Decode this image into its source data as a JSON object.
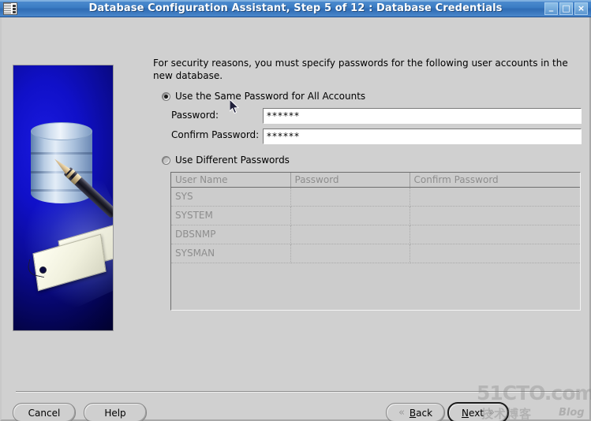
{
  "window": {
    "title": "Database Configuration Assistant, Step 5 of 12 : Database Credentials",
    "app_icon": "database-config-icon",
    "controls": {
      "minimize": "_",
      "maximize": "□",
      "close": "×"
    }
  },
  "main": {
    "instructions": "For security reasons, you must specify passwords for the following user accounts in the new database.",
    "same_password_option": {
      "label": "Use the Same Password for All Accounts",
      "selected": true
    },
    "different_password_option": {
      "label": "Use Different Passwords",
      "selected": false
    },
    "fields": {
      "password_label": "Password:",
      "password_value": "******",
      "confirm_label": "Confirm Password:",
      "confirm_value": "******"
    },
    "accounts_table": {
      "columns": [
        "User Name",
        "Password",
        "Confirm Password"
      ],
      "rows": [
        {
          "user_name": "SYS",
          "password": "",
          "confirm_password": ""
        },
        {
          "user_name": "SYSTEM",
          "password": "",
          "confirm_password": ""
        },
        {
          "user_name": "DBSNMP",
          "password": "",
          "confirm_password": ""
        },
        {
          "user_name": "SYSMAN",
          "password": "",
          "confirm_password": ""
        }
      ],
      "enabled": false
    }
  },
  "footer": {
    "cancel_label": "Cancel",
    "help_label": "Help",
    "back_label": "Back",
    "back_mnemonic": "B",
    "back_rest": "ack",
    "next_label": "Next",
    "next_mnemonic": "N",
    "next_rest": "ext",
    "back_chevron": "«",
    "next_chevron": "»",
    "next_is_default": true
  },
  "watermark": {
    "main": "51CTO.com",
    "chinese": "技术博客",
    "blog": "Blog"
  },
  "colors": {
    "titlebar_blue": "#3b7cc4",
    "dialog_gray": "#d0d0d0",
    "panel_blue": "#1010c8",
    "disabled_text": "#8e8e8e",
    "field_white": "#ffffff"
  }
}
